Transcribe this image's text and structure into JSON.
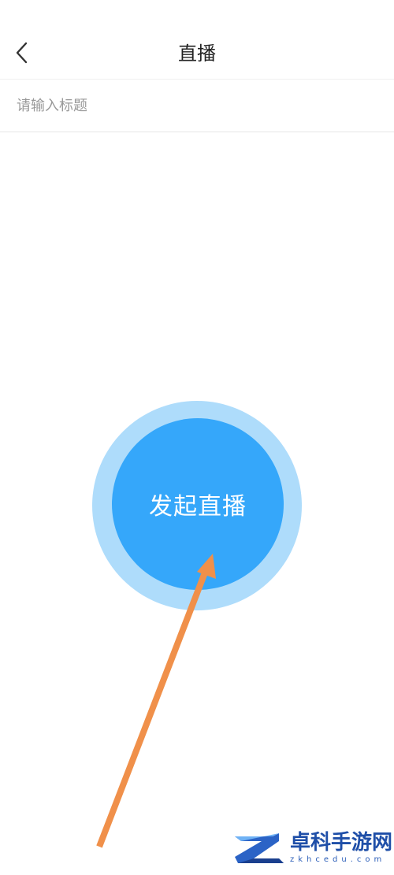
{
  "header": {
    "title": "直播",
    "back_icon": "chevron-left-icon"
  },
  "title_input": {
    "placeholder": "请输入标题",
    "value": ""
  },
  "live_button": {
    "label": "发起直播",
    "color": "#35a7fa",
    "ring_color": "#aedcfb"
  },
  "annotation": {
    "arrow_color": "#f0904a"
  },
  "watermark": {
    "name": "卓科手游网",
    "url": "zkhcedu.com"
  }
}
